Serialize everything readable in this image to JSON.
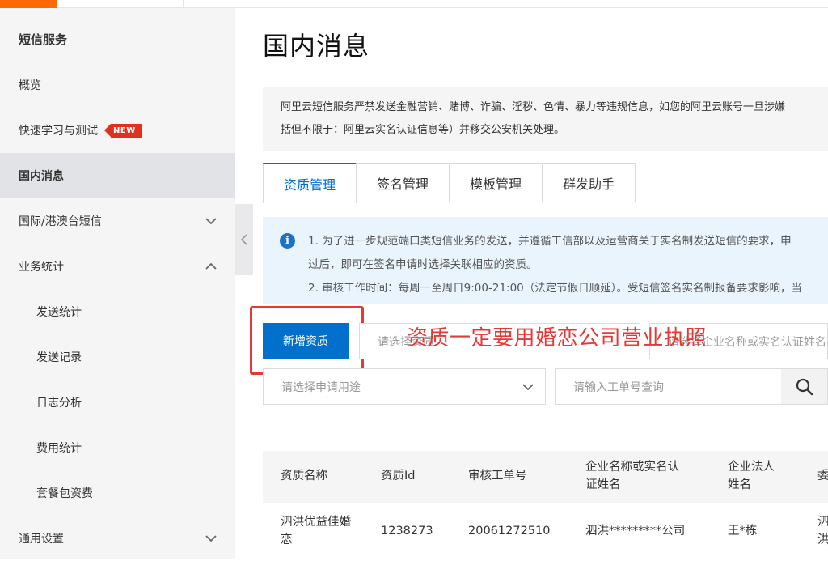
{
  "sidebar": {
    "title": "短信服务",
    "items": [
      {
        "label": "概览"
      },
      {
        "label": "快速学习与测试",
        "badge": "NEW"
      },
      {
        "label": "国内消息"
      },
      {
        "label": "国际/港澳台短信"
      },
      {
        "label": "业务统计"
      },
      {
        "label": "发送统计"
      },
      {
        "label": "发送记录"
      },
      {
        "label": "日志分析"
      },
      {
        "label": "费用统计"
      },
      {
        "label": "套餐包资费"
      },
      {
        "label": "通用设置"
      }
    ]
  },
  "main": {
    "title": "国内消息",
    "notice": [
      "阿里云短信服务严禁发送金融营销、赌博、诈骗、淫秽、色情、暴力等违规信息，如您的阿里云账号一旦涉嫌",
      "括但不限于：阿里云实名认证信息等）并移交公安机关处理。"
    ],
    "tabs": [
      "资质管理",
      "签名管理",
      "模板管理",
      "群发助手"
    ],
    "info": [
      "1. 为了进一步规范端口类短信业务的发送，并遵循工信部以及运营商关于实名制发送短信的要求，申",
      "过后，即可在签名申请时选择关联相应的资质。",
      "2. 审核工作时间：每周一至周日9:00-21:00（法定节假日顺延）。受短信签名实名制报备要求影响，当"
    ],
    "add_button": "新增资质",
    "filter_placeholder_1": "请选择资质",
    "filter_placeholder_2": "请选择企业名称或实名认证姓名",
    "purpose_placeholder": "请选择申请用途",
    "order_placeholder": "请输入工单号查询",
    "annotation": "资质一定要用婚恋公司营业执照"
  },
  "table": {
    "columns": [
      "资质名称",
      "资质Id",
      "审核工单号",
      "企业名称或实名认证姓名",
      "企业法人姓名",
      "委"
    ],
    "rows": [
      {
        "name": "泗洪优益佳婚恋",
        "id": "1238273",
        "order": "20061272510",
        "company": "泗洪*********公司",
        "legal": "王*栋",
        "extra": "泗洪"
      }
    ]
  }
}
